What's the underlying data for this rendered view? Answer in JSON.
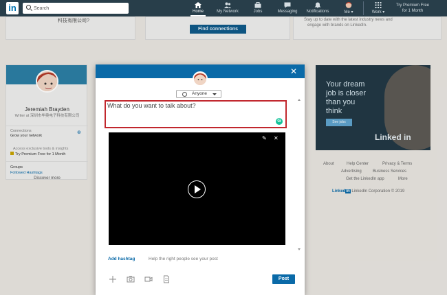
{
  "nav": {
    "logo": "in",
    "search_placeholder": "Search",
    "items": [
      {
        "label": "Home",
        "icon": "home-icon"
      },
      {
        "label": "My Network",
        "icon": "network-icon"
      },
      {
        "label": "Jobs",
        "icon": "briefcase-icon"
      },
      {
        "label": "Messaging",
        "icon": "chat-icon"
      },
      {
        "label": "Notifications",
        "icon": "bell-icon"
      },
      {
        "label": "Me",
        "icon": "avatar-icon"
      },
      {
        "label": "Work",
        "icon": "grid-icon"
      }
    ],
    "premium_line1": "Try Premium Free",
    "premium_line2": "for 1 Month"
  },
  "background": {
    "top_left_text": "科技有限公司?",
    "find_connections": "Find connections",
    "top_right_text_1": "Stay up to date with the latest industry news and",
    "top_right_text_2": "engage with brands on LinkedIn.",
    "profile": {
      "name": "Jeremiah Brayden",
      "headline": "Writer at 深圳市毕奥电子科技有限公司",
      "connections_label": "Connections",
      "connections_sub": "Grow your network",
      "exclusive": "Access exclusive tools & insights",
      "premium": "Try Premium Free for 1 Month",
      "groups": "Groups",
      "followed": "Followed Hashtags",
      "discover": "Discover more"
    },
    "ad": {
      "line1": "Your dream",
      "line2": "job is closer",
      "line3": "than you",
      "line4": "think",
      "cta": "See jobs",
      "brand": "Linked in"
    },
    "footer": {
      "about": "About",
      "help": "Help Center",
      "privacy": "Privacy & Terms",
      "advertising": "Advertising",
      "business": "Business Services",
      "app": "Get the LinkedIn app",
      "more": "More",
      "copyright": "LinkedIn Corporation © 2019"
    }
  },
  "modal": {
    "audience": "Anyone",
    "placeholder": "What do you want to talk about?",
    "add_hashtag": "Add hashtag",
    "hashtag_hint": "Help the right people see your post",
    "post": "Post"
  }
}
